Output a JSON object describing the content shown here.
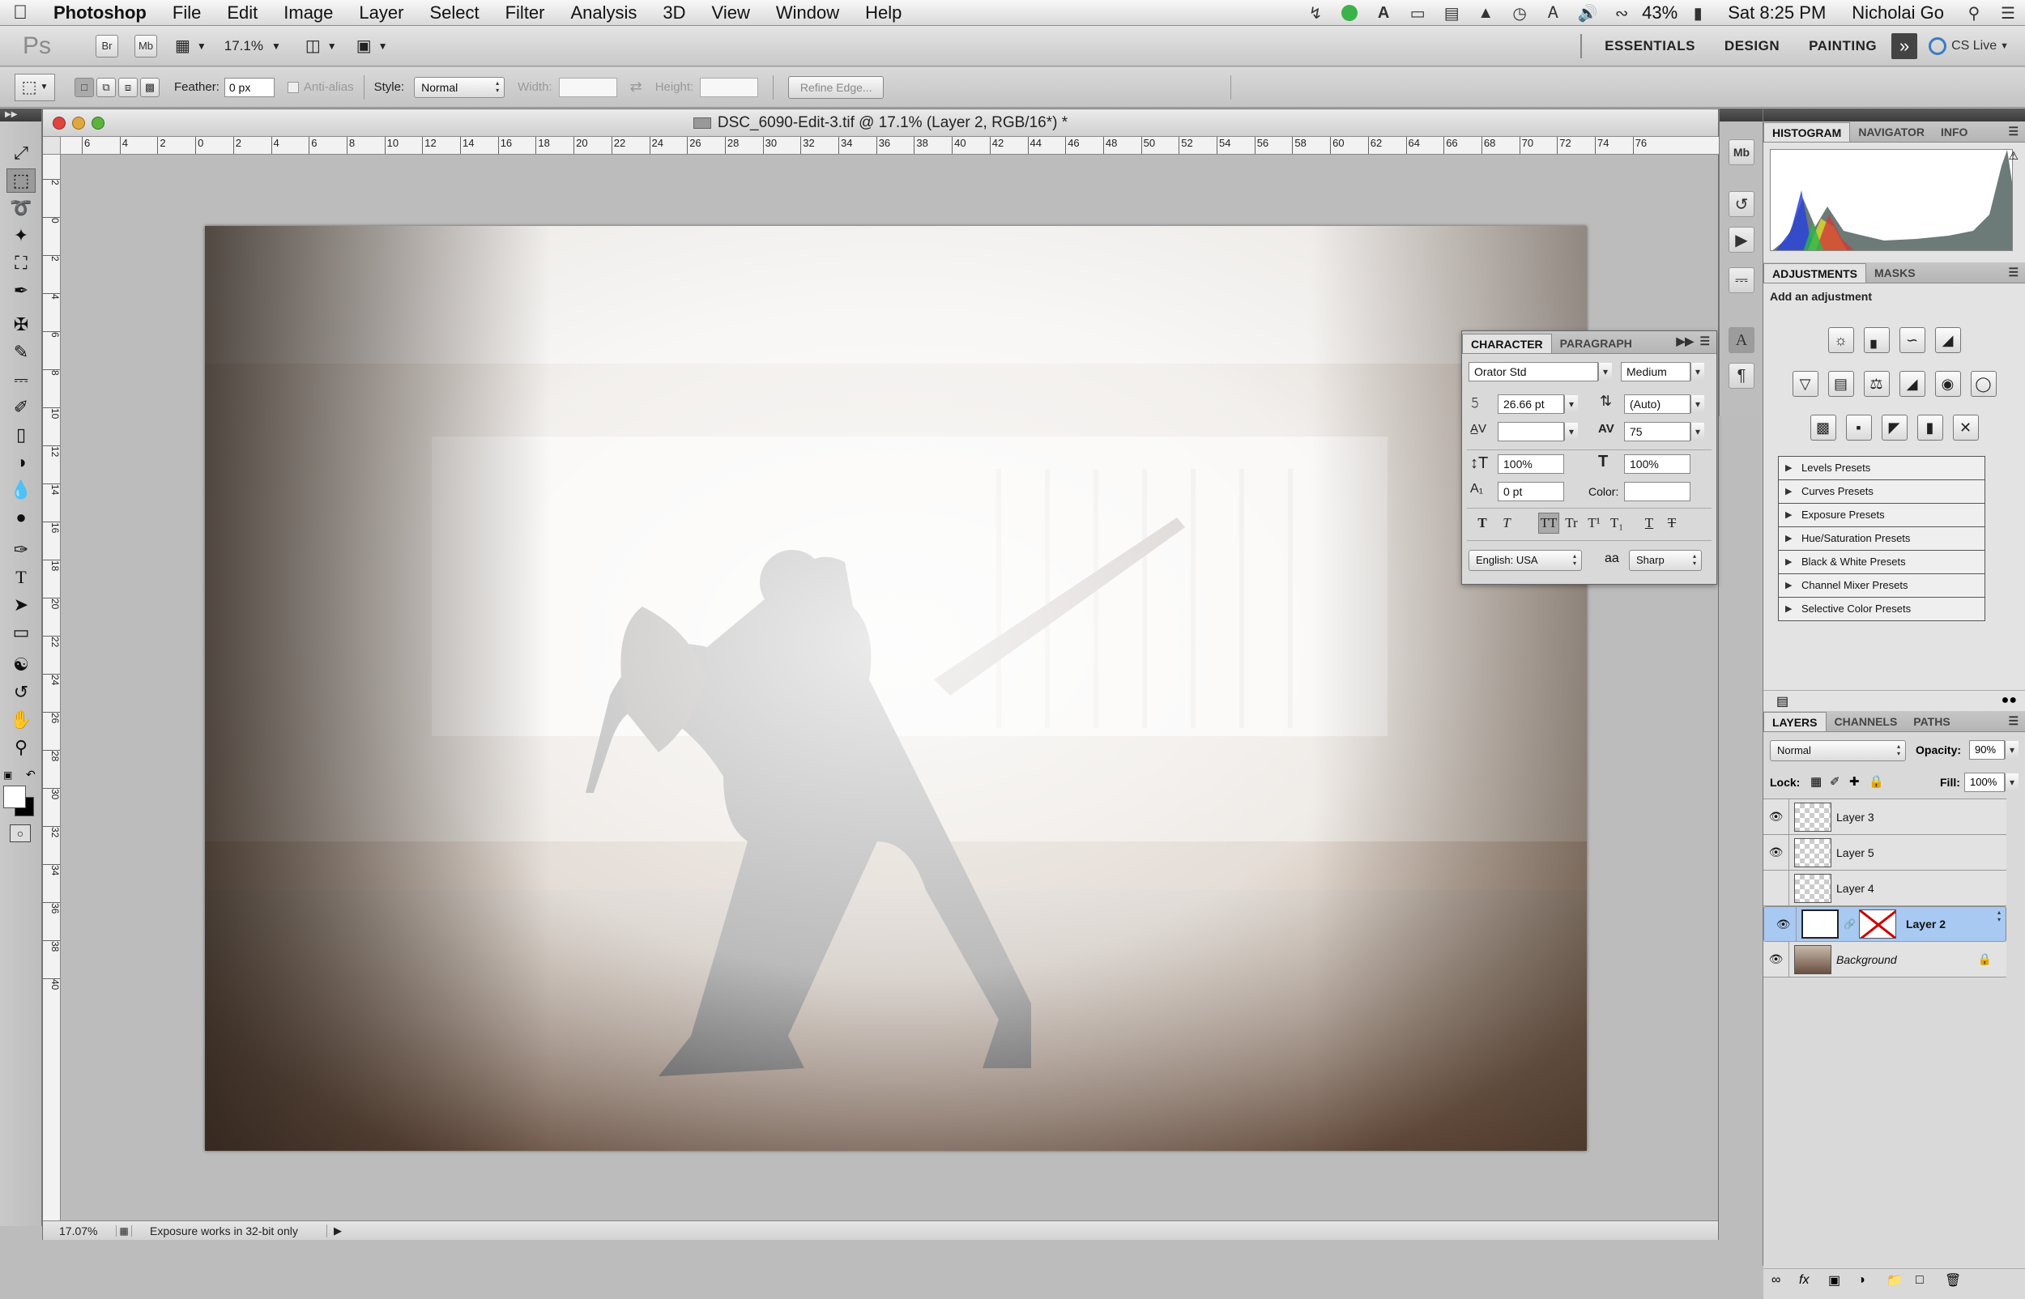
{
  "menubar": {
    "app_name": "Photoshop",
    "items": [
      "File",
      "Edit",
      "Image",
      "Layer",
      "Select",
      "Filter",
      "Analysis",
      "3D",
      "View",
      "Window",
      "Help"
    ],
    "battery": "43%",
    "clock": "Sat 8:25 PM",
    "user": "Nicholai Go"
  },
  "appbar": {
    "ps_logo": "Ps",
    "br_label": "Br",
    "mb_label": "Mb",
    "zoom": "17.1%",
    "workspaces": [
      "ESSENTIALS",
      "DESIGN",
      "PAINTING"
    ],
    "more": "»",
    "cs_live": "CS Live"
  },
  "options": {
    "feather_label": "Feather:",
    "feather_value": "0 px",
    "anti_alias_label": "Anti-alias",
    "style_label": "Style:",
    "style_value": "Normal",
    "width_label": "Width:",
    "height_label": "Height:",
    "refine_edge": "Refine Edge..."
  },
  "document": {
    "title": "DSC_6090-Edit-3.tif @ 17.1% (Layer 2, RGB/16*) *",
    "ruler_h": [
      "6",
      "4",
      "2",
      "0",
      "2",
      "4",
      "6",
      "8",
      "10",
      "12",
      "14",
      "16",
      "18",
      "20",
      "22",
      "24",
      "26",
      "28",
      "30",
      "32",
      "34",
      "36",
      "38",
      "40",
      "42",
      "44",
      "46",
      "48",
      "50",
      "52",
      "54",
      "56",
      "58",
      "60",
      "62",
      "64",
      "66",
      "68",
      "70",
      "72",
      "74",
      "76"
    ],
    "ruler_v": [
      "2",
      "0",
      "2",
      "4",
      "6",
      "8",
      "10",
      "12",
      "14",
      "16",
      "18",
      "20",
      "22",
      "24",
      "26",
      "28",
      "30",
      "32",
      "34",
      "36",
      "38",
      "40"
    ],
    "status_zoom": "17.07%",
    "status_text": "Exposure works in 32-bit only"
  },
  "character": {
    "tabs": [
      "CHARACTER",
      "PARAGRAPH"
    ],
    "font_family": "Orator Std",
    "font_style": "Medium",
    "size": "26.66 pt",
    "leading": "(Auto)",
    "kerning": "",
    "tracking": "75",
    "vscale": "100%",
    "hscale": "100%",
    "baseline": "0 pt",
    "color_label": "Color:",
    "language": "English: USA",
    "aa_label": "aa",
    "antialias": "Sharp",
    "styles": [
      "T",
      "T",
      "TT",
      "Tr",
      "T¹",
      "T₁",
      "T",
      "T"
    ]
  },
  "histogram_panel": {
    "tabs": [
      "HISTOGRAM",
      "NAVIGATOR",
      "INFO"
    ]
  },
  "adjustments_panel": {
    "tabs": [
      "ADJUSTMENTS",
      "MASKS"
    ],
    "heading": "Add an adjustment",
    "presets": [
      "Levels Presets",
      "Curves Presets",
      "Exposure Presets",
      "Hue/Saturation Presets",
      "Black & White Presets",
      "Channel Mixer Presets",
      "Selective Color Presets"
    ]
  },
  "layers_panel": {
    "tabs": [
      "LAYERS",
      "CHANNELS",
      "PATHS"
    ],
    "blend_mode": "Normal",
    "opacity_label": "Opacity:",
    "opacity": "90%",
    "lock_label": "Lock:",
    "fill_label": "Fill:",
    "fill": "100%",
    "layers": [
      {
        "name": "Layer 3",
        "visible": true
      },
      {
        "name": "Layer 5",
        "visible": true
      },
      {
        "name": "Layer 4",
        "visible": false
      },
      {
        "name": "Layer 2",
        "visible": true,
        "selected": true
      },
      {
        "name": "Background",
        "visible": true
      }
    ]
  }
}
